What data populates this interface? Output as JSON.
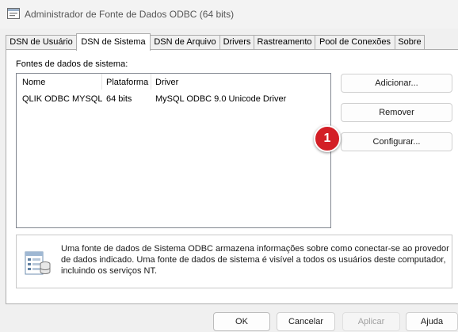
{
  "window": {
    "title": "Administrador de Fonte de Dados ODBC (64 bits)",
    "icon": "odbc-admin-icon"
  },
  "tabs": [
    {
      "label": "DSN de Usuário",
      "selected": false
    },
    {
      "label": "DSN de Sistema",
      "selected": true
    },
    {
      "label": "DSN de Arquivo",
      "selected": false
    },
    {
      "label": "Drivers",
      "selected": false
    },
    {
      "label": "Rastreamento",
      "selected": false
    },
    {
      "label": "Pool de Conexões",
      "selected": false
    },
    {
      "label": "Sobre",
      "selected": false
    }
  ],
  "system_dsn": {
    "group_label": "Fontes de dados de sistema:",
    "columns": [
      "Nome",
      "Plataforma",
      "Driver"
    ],
    "rows": [
      {
        "name": "QLIK ODBC MYSQL",
        "platform": "64 bits",
        "driver": "MySQL ODBC 9.0 Unicode Driver"
      }
    ],
    "buttons": {
      "add": "Adicionar...",
      "remove": "Remover",
      "configure": "Configurar..."
    },
    "callout": "1",
    "info": {
      "icon": "database-info-icon",
      "text": "Uma fonte de dados de Sistema ODBC armazena informações sobre como conectar-se ao provedor de dados indicado. Uma fonte de dados de sistema é visível a todos os usuários deste computador, incluindo os serviços NT."
    }
  },
  "footer": {
    "ok": "OK",
    "cancel": "Cancelar",
    "apply": "Aplicar",
    "apply_enabled": false,
    "help": "Ajuda"
  },
  "colors": {
    "callout": "#d31f26",
    "window_bg": "#f0f0f0",
    "panel_bg": "#ffffff"
  }
}
